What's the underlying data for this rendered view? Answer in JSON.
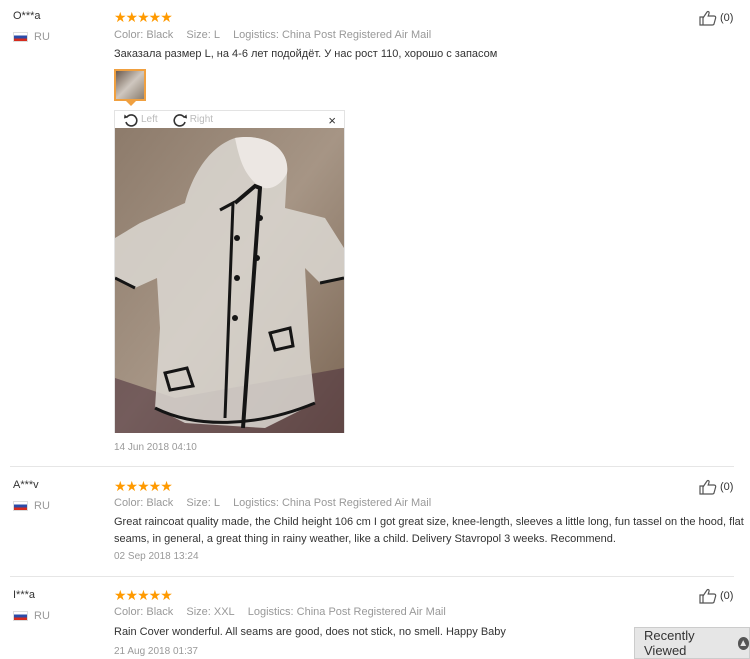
{
  "reviews": [
    {
      "user": "O***a",
      "country": "RU",
      "stars": "★★★★★",
      "color": "Color: Black",
      "size": "Size: L",
      "logistics": "Logistics: China Post Registered Air Mail",
      "text": "Заказала размер L, на 4-6 лет подойдёт. У нас рост 110, хорошо с запасом",
      "date": "14 Jun 2018 04:10",
      "helpful": "(0)"
    },
    {
      "user": "A***v",
      "country": "RU",
      "stars": "★★★★★",
      "color": "Color: Black",
      "size": "Size: L",
      "logistics": "Logistics: China Post Registered Air Mail",
      "text": "Great raincoat quality made, the Child height 106 cm I got great size, knee-length, sleeves a little long, fun tassel on the hood, flat seams, in general, a great thing in rainy weather, like a child. Delivery Stavropol 3 weeks. Recommend.",
      "date": "02 Sep 2018 13:24",
      "helpful": "(0)"
    },
    {
      "user": "I***a",
      "country": "RU",
      "stars": "★★★★★",
      "color": "Color: Black",
      "size": "Size: XXL",
      "logistics": "Logistics: China Post Registered Air Mail",
      "text": "Rain Cover wonderful. All seams are good, does not stick, no smell. Happy Baby",
      "date": "21 Aug 2018 01:37",
      "helpful": "(0)"
    }
  ],
  "viewer": {
    "left_label": "Left",
    "right_label": "Right",
    "close": "×"
  },
  "recently_viewed": {
    "label": "Recently Viewed",
    "icon": "chevron-up-icon"
  },
  "colors": {
    "star": "#ff9a00",
    "thumb_border": "#f0a040"
  }
}
